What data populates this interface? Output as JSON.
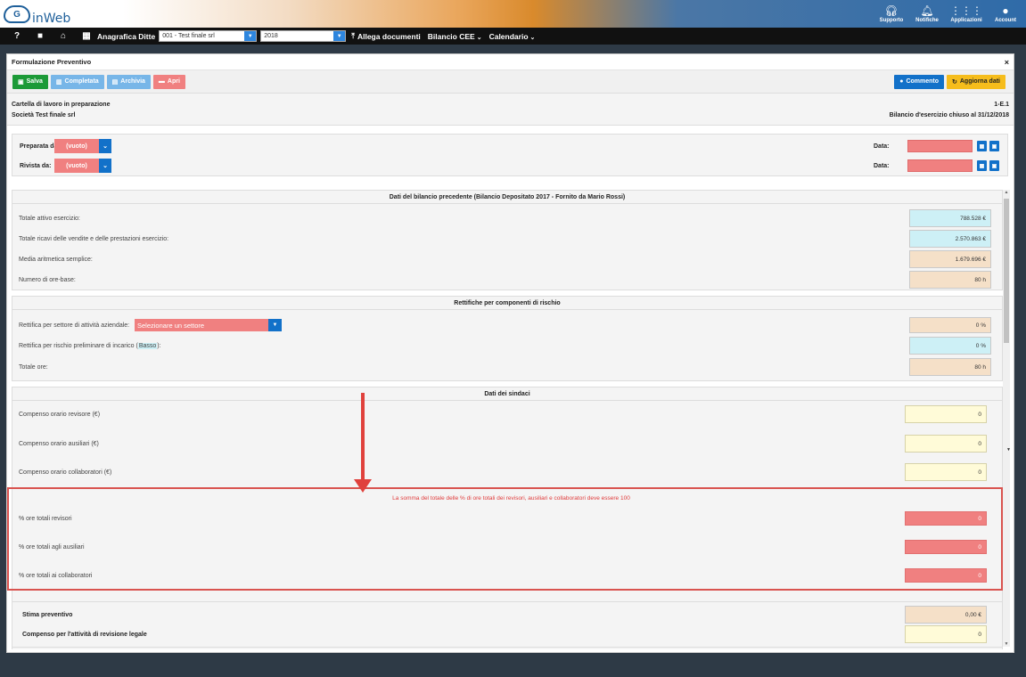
{
  "header": {
    "logo_text": "inWeb",
    "logo_mark": "G",
    "icons": [
      {
        "icon": "headphones-icon",
        "label": "Supporto"
      },
      {
        "icon": "bell-icon",
        "label": "Notifiche"
      },
      {
        "icon": "grid-icon",
        "label": "Applicazioni"
      },
      {
        "icon": "user-icon",
        "label": "Account"
      }
    ]
  },
  "nav": {
    "anagrafica_label": "Anagrafica Ditte",
    "company_select": "001 - Test finale srl",
    "year_select": "2018",
    "allega_label": "Allega documenti",
    "bilancio_label": "Bilancio CEE",
    "calendario_label": "Calendario"
  },
  "panel": {
    "title": "Formulazione Preventivo",
    "close": "×"
  },
  "toolbar": {
    "salva": "Salva",
    "completata": "Completata",
    "archivia": "Archivia",
    "apri": "Apri",
    "commento": "Commento",
    "aggiorna": "Aggiorna dati"
  },
  "info": {
    "status": "Cartella di lavoro in preparazione",
    "code": "1-E.1",
    "company": "Società Test finale srl",
    "period": "Bilancio d'esercizio chiuso al 31/12/2018"
  },
  "sign": {
    "preparata_label": "Preparata da:",
    "preparata_value": "(vuoto)",
    "rivista_label": "Rivista da:",
    "rivista_value": "(vuoto)",
    "data_label": "Data:"
  },
  "section_prev": {
    "title": "Dati del bilancio precedente (Bilancio Depositato 2017 - Fornito da Mario Rossi)",
    "rows": [
      {
        "label": "Totale attivo esercizio:",
        "value": "788.528 €"
      },
      {
        "label": "Totale ricavi delle vendite e delle prestazioni esercizio:",
        "value": "2.570.863 €"
      },
      {
        "label": "Media aritmetica semplice:",
        "value": "1.679.696 €"
      },
      {
        "label": "Numero di ore-base:",
        "value": "80 h"
      }
    ]
  },
  "section_rett": {
    "title": "Rettifiche per componenti di rischio",
    "settore_label": "Rettifica per settore di attività aziendale:",
    "settore_placeholder": "Selezionare un settore",
    "settore_value": "0 %",
    "rischio_label_pre": "Rettifica per rischio preliminare di incarico (",
    "rischio_level": "Basso",
    "rischio_label_post": "):",
    "rischio_value": "0 %",
    "totale_label": "Totale ore:",
    "totale_value": "80 h"
  },
  "section_sindaci": {
    "title": "Dati dei sindaci",
    "rows": [
      {
        "label": "Compenso orario revisore (€)",
        "value": "0"
      },
      {
        "label": "Compenso orario ausiliari (€)",
        "value": "0"
      },
      {
        "label": "Compenso orario collaboratori (€)",
        "value": "0"
      }
    ],
    "warning": "La somma del totale delle % di ore totali dei revisori, ausiliari e collaboratori deve essere 100",
    "pct_rows": [
      {
        "label": "% ore totali revisori",
        "value": "0"
      },
      {
        "label": "% ore totali agli ausiliari",
        "value": "0"
      },
      {
        "label": "% ore totali ai collaboratori",
        "value": "0"
      }
    ]
  },
  "stima": {
    "stima_label": "Stima preventivo",
    "stima_value": "0,00 €",
    "compenso_label": "Compenso per l'attività di revisione legale",
    "compenso_value": "0"
  },
  "colors": {
    "error_red": "#f08080",
    "primary_blue": "#1271c9",
    "success_green": "#1c9a37",
    "annotation_red": "#e0413c"
  }
}
